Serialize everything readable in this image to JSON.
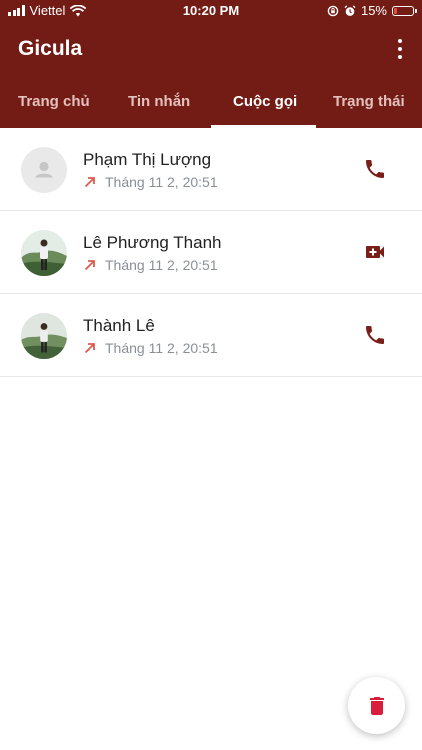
{
  "status_bar": {
    "carrier": "Viettel",
    "time": "10:20 PM",
    "battery": "15%",
    "battery_level": 0.15
  },
  "app": {
    "title": "Gicula",
    "menu_icon": "more-vert-icon"
  },
  "tabs": [
    {
      "label": "Trang chủ",
      "active": false
    },
    {
      "label": "Tin nhắn",
      "active": false
    },
    {
      "label": "Cuộc gọi",
      "active": true
    },
    {
      "label": "Trạng thái",
      "active": false
    }
  ],
  "calls": [
    {
      "name": "Phạm Thị Lượng",
      "time": "Tháng 11 2, 20:51",
      "direction": "outgoing",
      "call_type": "voice",
      "avatar": "placeholder"
    },
    {
      "name": "Lê Phương Thanh",
      "time": "Tháng 11 2, 20:51",
      "direction": "outgoing",
      "call_type": "video",
      "avatar": "photo"
    },
    {
      "name": "Thành Lê",
      "time": "Tháng 11 2, 20:51",
      "direction": "outgoing",
      "call_type": "voice",
      "avatar": "photo"
    }
  ],
  "fab": {
    "icon": "trash-icon"
  },
  "colors": {
    "brand": "#731c15",
    "outgoing_arrow": "#e05a4e",
    "action_icon": "#7a1f18",
    "delete": "#d81e3a"
  }
}
